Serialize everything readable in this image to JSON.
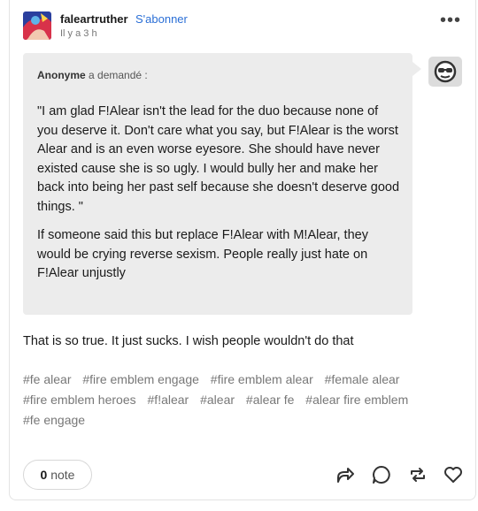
{
  "post": {
    "blog_name": "faleartruther",
    "follow_label": "S'abonner",
    "timestamp": "Il y a 3 h",
    "more_label": "•••"
  },
  "ask": {
    "asker": "Anonyme",
    "asked_label": "a demandé :",
    "paragraphs": [
      "\"I am glad F!Alear isn't the lead for the duo because none of you deserve it. Don't care what you say, but F!Alear is the worst Alear and is an even worse eyesore. She should have never existed cause she is so ugly. I would bully her and make her back into being her past self because she doesn't deserve good things. \"",
      "If someone said this but replace F!Alear with M!Alear, they would be crying reverse sexism. People really just hate on F!Alear unjustly"
    ]
  },
  "answer": "That is so true. It just sucks. I wish people wouldn't do that",
  "tags": [
    "#fe alear",
    "#fire emblem engage",
    "#fire emblem alear",
    "#female alear",
    "#fire emblem heroes",
    "#f!alear",
    "#alear",
    "#alear fe",
    "#alear fire emblem",
    "#fe engage"
  ],
  "footer": {
    "note_count": "0",
    "note_label": "note"
  },
  "icons": [
    "share-icon",
    "reply-icon",
    "reblog-icon",
    "like-icon"
  ],
  "colors": {
    "follow": "#2b6fd6",
    "bubble": "#ececec"
  }
}
